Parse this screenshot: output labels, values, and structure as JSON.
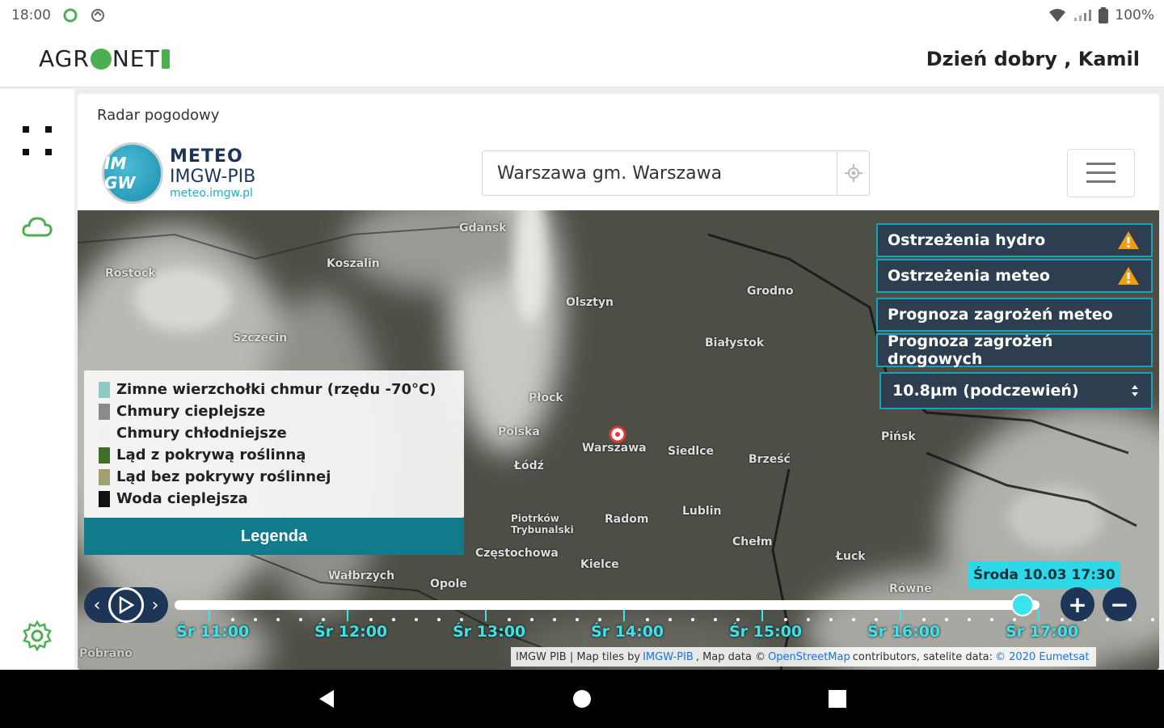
{
  "status_bar": {
    "time": "18:00",
    "battery": "100%"
  },
  "header": {
    "brand_a": "AGR",
    "brand_b": "NET",
    "greeting": "Dzień dobry , Kamil"
  },
  "card": {
    "title": "Radar pogodowy",
    "logo": {
      "circle_text": "IM GW",
      "line1": "METEO",
      "line2": "IMGW-PIB",
      "line3": "meteo.imgw.pl"
    },
    "search": {
      "value": "Warszawa gm. Warszawa"
    }
  },
  "map": {
    "cities": [
      {
        "name": "Gdańsk"
      },
      {
        "name": "Olsztyn"
      },
      {
        "name": "Szczecin"
      },
      {
        "name": "Koszalin"
      },
      {
        "name": "Białystok"
      },
      {
        "name": "Polska"
      },
      {
        "name": "Warszawa"
      },
      {
        "name": "Łódź"
      },
      {
        "name": "Płock"
      },
      {
        "name": "Lublin"
      },
      {
        "name": "Radom"
      },
      {
        "name": "Kielce"
      },
      {
        "name": "Siedlce"
      },
      {
        "name": "Grodno"
      },
      {
        "name": "Rostock"
      },
      {
        "name": "Częstochowa"
      },
      {
        "name": "Piotrków Trybunalski"
      },
      {
        "name": "Opole"
      },
      {
        "name": "Brześć"
      },
      {
        "name": "Wałbrzych"
      },
      {
        "name": "Łuck"
      },
      {
        "name": "Równe"
      },
      {
        "name": "Chełm"
      },
      {
        "name": "Pińsk"
      }
    ],
    "legend": {
      "items": [
        {
          "label": "Zimne wierzchołki chmur (rzędu -70°C)",
          "color": "#8ec9c4"
        },
        {
          "label": "Chmury cieplejsze",
          "color": "#8a8a8a"
        },
        {
          "label": "Chmury chłodniejsze",
          "color": "#f0f0f0"
        },
        {
          "label": "Ląd z pokrywą roślinną",
          "color": "#3f6e2a"
        },
        {
          "label": "Ląd bez pokrywy roślinnej",
          "color": "#a0a070"
        },
        {
          "label": "Woda cieplejsza",
          "color": "#111111"
        }
      ],
      "button": "Legenda"
    },
    "panel": {
      "items": [
        {
          "label": "Ostrzeżenia hydro",
          "warn": true
        },
        {
          "label": "Ostrzeżenia meteo",
          "warn": true
        },
        {
          "label": "Prognoza zagrożeń meteo",
          "warn": false
        },
        {
          "label": "Prognoza zagrożeń drogowych",
          "warn": false
        }
      ],
      "select": "10.8µm (podczewień)"
    },
    "timeline": {
      "current": "Środa 10.03 17:30",
      "labels": [
        "Śr 11:00",
        "Śr 12:00",
        "Śr 13:00",
        "Śr 14:00",
        "Śr 15:00",
        "Śr 16:00",
        "Śr 17:00"
      ],
      "progress": 0.98,
      "zoom_in": "+",
      "zoom_out": "−"
    },
    "attribution": {
      "a": "IMGW PIB | Map tiles by",
      "b": "IMGW-PIB",
      "c": ", Map data ©",
      "d": "OpenStreetMap",
      "e": "contributors, satelite data:",
      "f": "© 2020 Eumetsat"
    },
    "bottom_left_text": "Pobrano"
  },
  "colors": {
    "accent": "#117a8b",
    "panel_bg": "#2c3e50",
    "timeline_cyan": "#3be3ec",
    "green": "#4caf50"
  }
}
